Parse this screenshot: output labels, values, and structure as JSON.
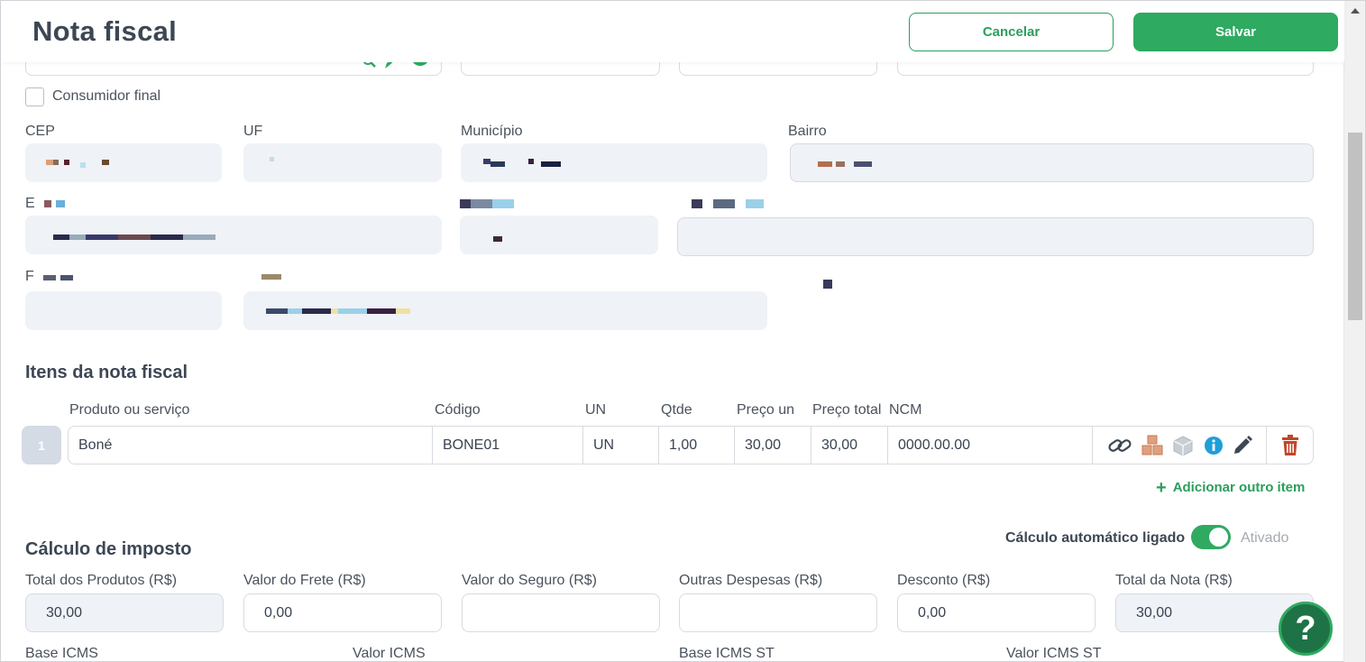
{
  "header": {
    "title": "Nota fiscal",
    "cancel_label": "Cancelar",
    "save_label": "Salvar"
  },
  "customer": {
    "consumidor_final_label": "Consumidor final",
    "cep_label": "CEP",
    "uf_label": "UF",
    "municipio_label": "Município",
    "bairro_label": "Bairro",
    "row3_label1_visible": "E",
    "row4_label1_visible": "F"
  },
  "items_section": {
    "title": "Itens da nota fiscal",
    "columns": [
      "Produto ou serviço",
      "Código",
      "UN",
      "Qtde",
      "Preço un",
      "Preço total",
      "NCM"
    ],
    "rows": [
      {
        "number": "1",
        "produto": "Boné",
        "codigo": "BONE01",
        "un": "UN",
        "qtde": "1,00",
        "preco_un": "30,00",
        "preco_total": "30,00",
        "ncm": "0000.00.00"
      }
    ],
    "add_item_label": "Adicionar outro item"
  },
  "tax_section": {
    "title": "Cálculo de imposto",
    "auto_calc_label": "Cálculo automático ligado",
    "auto_calc_status": "Ativado",
    "fields": [
      {
        "label": "Total dos Produtos (R$)",
        "value": "30,00"
      },
      {
        "label": "Valor do Frete (R$)",
        "value": "0,00"
      },
      {
        "label": "Valor do Seguro (R$)",
        "value": ""
      },
      {
        "label": "Outras Despesas (R$)",
        "value": ""
      },
      {
        "label": "Desconto (R$)",
        "value": "0,00"
      },
      {
        "label": "Total da Nota (R$)",
        "value": "30,00"
      }
    ],
    "bottom_labels": [
      "Base ICMS",
      "Valor ICMS",
      "Base ICMS ST",
      "Valor ICMS ST"
    ]
  },
  "help_label": "?",
  "colors": {
    "primary_green": "#2faa61",
    "title_text": "#3d4754",
    "field_gray": "#eff2f6",
    "delete_red": "#c0462c",
    "info_blue": "#1f9ed8"
  }
}
